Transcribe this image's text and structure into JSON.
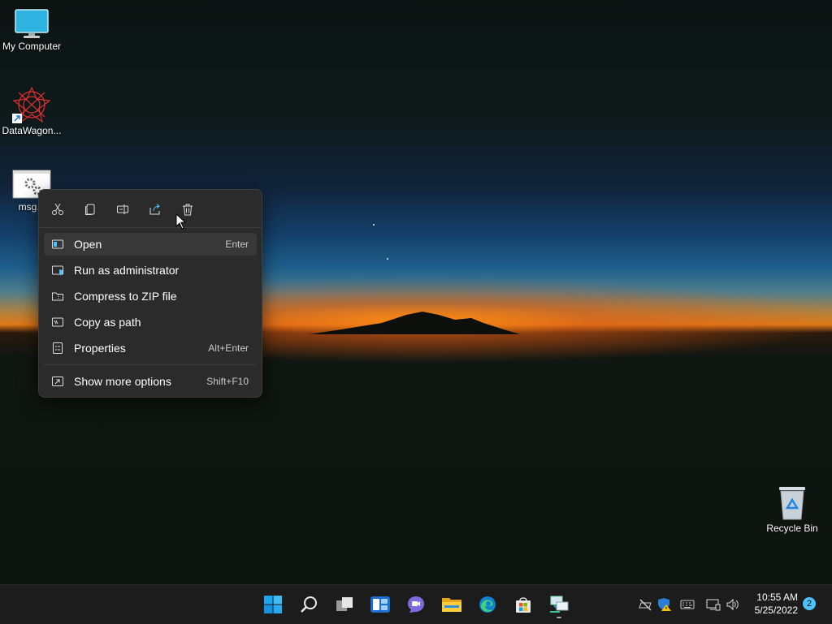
{
  "desktop": {
    "icons": [
      {
        "label": "My Computer"
      },
      {
        "label": "DataWagon..."
      },
      {
        "label": "msg.b"
      },
      {
        "label": "Recycle Bin"
      }
    ]
  },
  "context_menu": {
    "toolbar": [
      "cut-icon",
      "copy-icon",
      "rename-icon",
      "share-icon",
      "delete-icon"
    ],
    "items": [
      {
        "label": "Open",
        "shortcut": "Enter",
        "icon": "open-icon"
      },
      {
        "label": "Run as administrator",
        "shortcut": "",
        "icon": "shield-icon"
      },
      {
        "label": "Compress to ZIP file",
        "shortcut": "",
        "icon": "zip-icon"
      },
      {
        "label": "Copy as path",
        "shortcut": "",
        "icon": "path-icon"
      },
      {
        "label": "Properties",
        "shortcut": "Alt+Enter",
        "icon": "properties-icon"
      },
      {
        "label": "Show more options",
        "shortcut": "Shift+F10",
        "icon": "more-options-icon"
      }
    ]
  },
  "taskbar": {
    "apps": [
      "start-icon",
      "search-icon",
      "task-view-icon",
      "widgets-icon",
      "chat-icon",
      "file-explorer-icon",
      "edge-icon",
      "store-icon",
      "network-app-icon"
    ],
    "tray": [
      "network-off-icon",
      "defender-warning-icon",
      "keyboard-icon",
      "display-icon",
      "volume-icon"
    ],
    "time": "10:55 AM",
    "date": "5/25/2022",
    "notifications": "2"
  },
  "colors": {
    "accent": "#4cc2ff",
    "menu_bg": "#2b2b2b",
    "taskbar_bg": "#1c1c1c"
  }
}
